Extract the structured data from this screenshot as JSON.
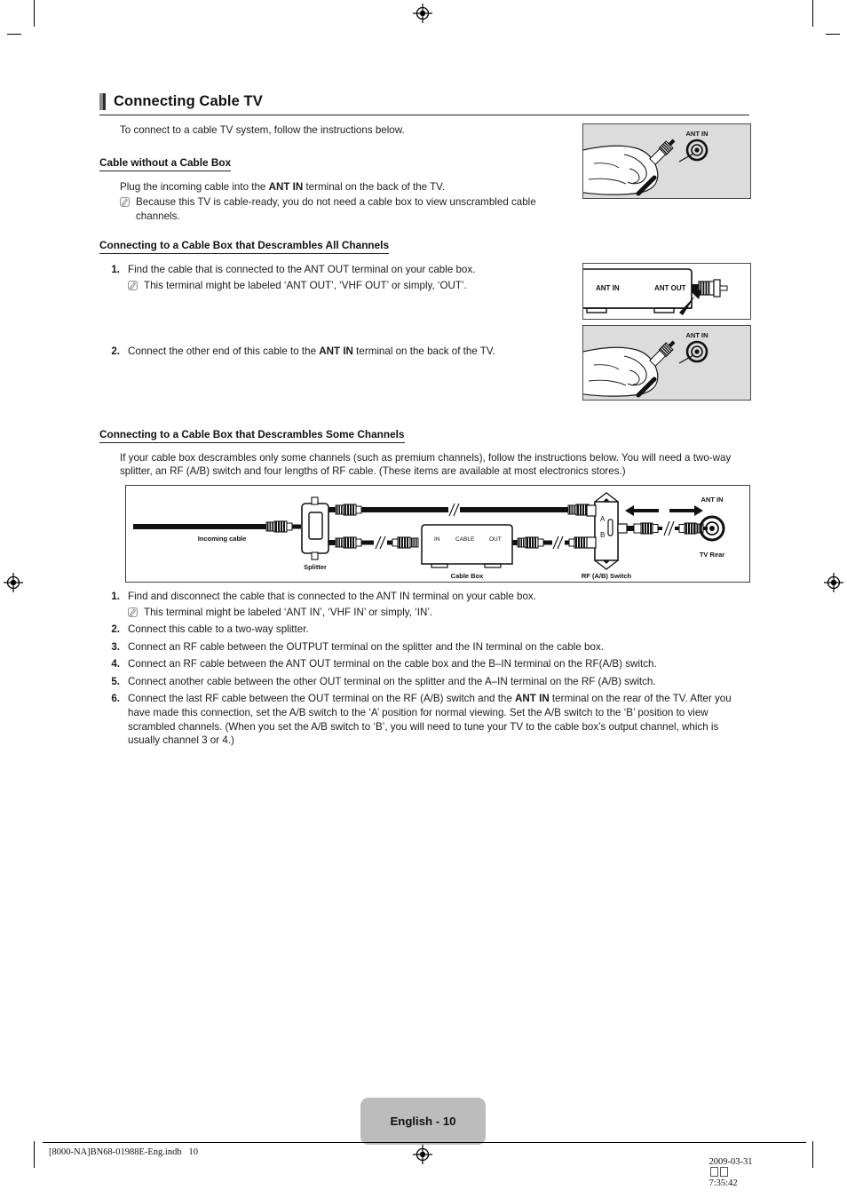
{
  "document": {
    "section_title": "Connecting Cable TV",
    "intro": "To connect to a cable TV system, follow the instructions below.",
    "page_label": "English - 10",
    "footer_left": "[8000-NA]BN68-01988E-Eng.indb   10",
    "footer_right_date": "2009-03-31",
    "footer_right_time": "7:35:42"
  },
  "sections": {
    "no_box": {
      "heading": "Cable without a Cable Box",
      "body_pre": "Plug the incoming cable into the ",
      "body_bold": "ANT IN",
      "body_post": " terminal on the back of the TV.",
      "note": "Because this TV is cable-ready, you do not need a cable box to view unscrambled cable channels."
    },
    "descrambles_all": {
      "heading": "Connecting to a Cable Box that Descrambles All Channels",
      "step1": {
        "num": "1.",
        "text": "Find the cable that is connected to the ANT OUT terminal on your cable box.",
        "note": "This terminal might be labeled ‘ANT OUT’, ‘VHF OUT’ or simply, ‘OUT’."
      },
      "step2": {
        "num": "2.",
        "pre": "Connect the other end of this cable to the ",
        "bold": "ANT IN",
        "post": " terminal on the back of the TV."
      }
    },
    "descrambles_some": {
      "heading": "Connecting to a Cable Box that Descrambles Some Channels",
      "intro": "If your cable box descrambles only some channels (such as premium channels), follow the instructions below. You will need a two-way splitter, an RF (A/B) switch and four lengths of RF cable. (These items are available at most electronics stores.)",
      "steps": [
        {
          "num": "1.",
          "text": "Find and disconnect the cable that is connected to the ANT IN terminal on your cable box.",
          "note": "This terminal might be labeled ‘ANT IN’, ‘VHF IN’ or simply, ‘IN’."
        },
        {
          "num": "2.",
          "text": "Connect this cable to a two-way splitter."
        },
        {
          "num": "3.",
          "text": "Connect an RF cable between the OUTPUT terminal on the splitter and the IN terminal on the cable box."
        },
        {
          "num": "4.",
          "text": "Connect an RF cable between the ANT OUT terminal on the cable box and the B–IN terminal on the RF(A/B) switch."
        },
        {
          "num": "5.",
          "text": "Connect another cable between the other OUT terminal on the splitter and the A–IN terminal on the RF (A/B) switch."
        },
        {
          "num": "6.",
          "pre": "Connect the last RF cable between the OUT terminal on the RF (A/B) switch and the ",
          "bold": "ANT IN",
          "post": " terminal on the rear of the TV. After you have made this connection, set the A/B switch to the ‘A’ position for normal viewing. Set the A/B switch to the ‘B’ position to view scrambled channels. (When you set the A/B switch to ‘B’, you will need to tune your TV to the cable box’s output channel, which is usually channel 3 or 4.)"
        }
      ]
    }
  },
  "illustrations": {
    "hand_ant_in_1": {
      "label": "ANT IN",
      "alt": "hand plugging coax cable into ANT IN jack"
    },
    "cable_box_rear": {
      "label_in": "ANT IN",
      "label_out": "ANT OUT",
      "alt": "cable box rear panel with ANT IN and ANT OUT terminals"
    },
    "hand_ant_in_2": {
      "label": "ANT IN",
      "alt": "hand plugging coax cable into ANT IN jack"
    }
  },
  "diagram": {
    "labels": {
      "incoming_cable": "Incoming cable",
      "splitter": "Splitter",
      "cable_box": "Cable Box",
      "cable_box_in": "IN",
      "cable_box_cable": "CABLE",
      "cable_box_out": "OUT",
      "rf_switch": "RF (A/B) Switch",
      "switch_a": "A",
      "switch_b": "B",
      "ant_in": "ANT IN",
      "tv_rear": "TV Rear"
    }
  },
  "colors": {
    "title_bar_gray": "#8a8a8a",
    "title_bar_dark": "#2b2b2b",
    "rule": "#231f20",
    "illustration_bg": "#dcdcdc",
    "page_tab_bg": "#bcbcbc",
    "text": "#1c1c1c"
  }
}
